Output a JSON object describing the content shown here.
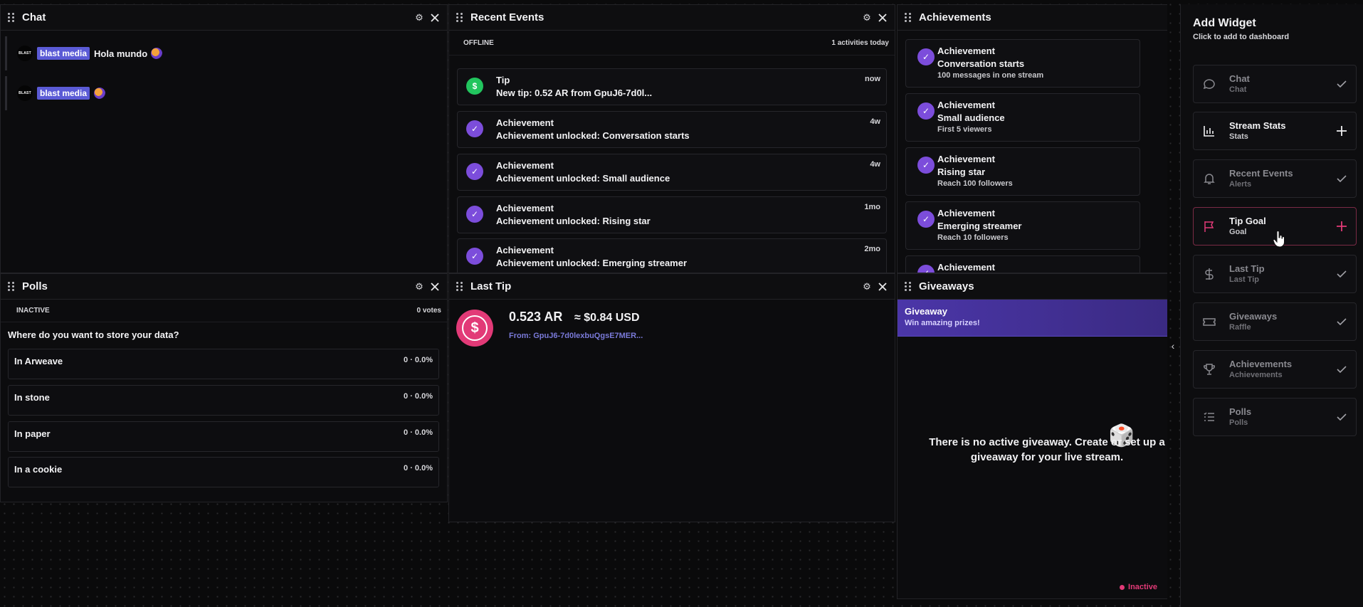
{
  "chat": {
    "title": "Chat",
    "messages": [
      {
        "avatar": "BLAST",
        "user": "blast media",
        "text": "Hola mundo"
      },
      {
        "avatar": "BLAST",
        "user": "blast media",
        "text": ""
      }
    ]
  },
  "recent_events": {
    "title": "Recent Events",
    "status": "OFFLINE",
    "activity": "1 activities today",
    "items": [
      {
        "type": "Tip",
        "desc": "New tip: 0.52 AR from GpuJ6-7d0l...",
        "time": "now",
        "icon": "$"
      },
      {
        "type": "Achievement",
        "desc": "Achievement unlocked: Conversation starts",
        "time": "4w",
        "icon": "✓"
      },
      {
        "type": "Achievement",
        "desc": "Achievement unlocked: Small audience",
        "time": "4w",
        "icon": "✓"
      },
      {
        "type": "Achievement",
        "desc": "Achievement unlocked: Rising star",
        "time": "1mo",
        "icon": "✓"
      },
      {
        "type": "Achievement",
        "desc": "Achievement unlocked: Emerging streamer",
        "time": "2mo",
        "icon": "✓"
      }
    ]
  },
  "achievements": {
    "title": "Achievements",
    "items": [
      {
        "label": "Achievement",
        "name": "Conversation starts",
        "desc": "100 messages in one stream"
      },
      {
        "label": "Achievement",
        "name": "Small audience",
        "desc": "First 5 viewers"
      },
      {
        "label": "Achievement",
        "name": "Rising star",
        "desc": "Reach 100 followers"
      },
      {
        "label": "Achievement",
        "name": "Emerging streamer",
        "desc": "Reach 10 followers"
      },
      {
        "label": "Achievement",
        "name": "",
        "desc": ""
      }
    ]
  },
  "polls": {
    "title": "Polls",
    "status": "INACTIVE",
    "votes": "0 votes",
    "question": "Where do you want to store your data?",
    "options": [
      {
        "label": "In Arweave",
        "value": "0 · 0.0%"
      },
      {
        "label": "In stone",
        "value": "0 · 0.0%"
      },
      {
        "label": "In paper",
        "value": "0 · 0.0%"
      },
      {
        "label": "In a cookie",
        "value": "0 · 0.0%"
      }
    ]
  },
  "last_tip": {
    "title": "Last Tip",
    "icon": "$",
    "amount": "0.523 AR",
    "usd": "≈ $0.84 USD",
    "from": "From: GpuJ6-7d0lexbuQgsE7MER..."
  },
  "giveaways": {
    "title": "Giveaways",
    "banner_title": "Giveaway",
    "banner_sub": "Win amazing prizes!",
    "empty_text": "There is no active giveaway. Create or set up a giveaway for your live stream.",
    "status": "Inactive",
    "die": "🎲"
  },
  "sidebar": {
    "title": "Add Widget",
    "subtitle": "Click to add to dashboard",
    "widgets": [
      {
        "name": "Chat",
        "category": "Chat",
        "added": true
      },
      {
        "name": "Stream Stats",
        "category": "Stats",
        "added": false
      },
      {
        "name": "Recent Events",
        "category": "Alerts",
        "added": true
      },
      {
        "name": "Tip Goal",
        "category": "Goal",
        "added": false
      },
      {
        "name": "Last Tip",
        "category": "Last Tip",
        "added": true
      },
      {
        "name": "Giveaways",
        "category": "Raffle",
        "added": true
      },
      {
        "name": "Achievements",
        "category": "Achievements",
        "added": true
      },
      {
        "name": "Polls",
        "category": "Polls",
        "added": true
      }
    ],
    "collapse_glyph": "‹"
  },
  "colors": {
    "accent_purple": "#7c4ddb",
    "tip_pink": "#e23a77",
    "tip_green": "#22c55e",
    "badge": "#5b5bd6"
  }
}
